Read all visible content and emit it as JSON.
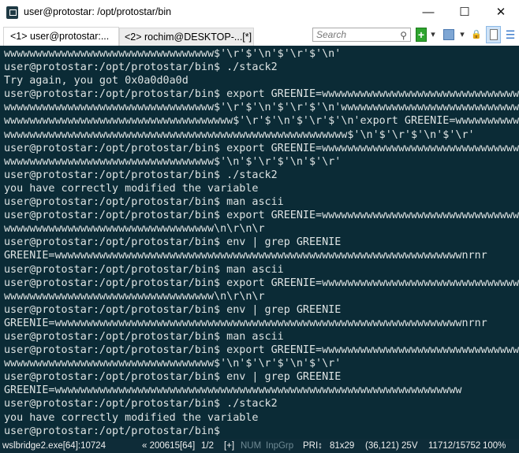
{
  "window": {
    "title": "user@protostar: /opt/protostar/bin",
    "minimize": "—",
    "maximize": "☐",
    "close": "✕"
  },
  "tabs": [
    {
      "label": "<1> user@protostar:...",
      "active": true
    },
    {
      "label": "<2> rochim@DESKTOP-...[*]",
      "active": false
    }
  ],
  "toolbar": {
    "search_placeholder": "Search",
    "search_icon": "⚲",
    "new_console": "+",
    "dropdown": "▾",
    "lock": "🔒",
    "menu": "☰"
  },
  "colors": {
    "terminal_bg": "#0b2b36",
    "terminal_fg": "#dde3e3",
    "new_console_green": "#2fa52f"
  },
  "terminal": {
    "lines": [
      "wwwwwwwwwwwwwwwwwwwwwwwwwwwwwwwww$'\\r'$'\\n'$'\\r'$'\\n'",
      "user@protostar:/opt/protostar/bin$ ./stack2",
      "Try again, you got 0x0a0d0a0d",
      "user@protostar:/opt/protostar/bin$ export GREENIE=wwwwwwwwwwwwwwwwwwwwwwwwwwwwwww",
      "wwwwwwwwwwwwwwwwwwwwwwwwwwwwwwwww$'\\r'$'\\n'$'\\r'$'\\n'wwwwwwwwwwwwwwwwwwwwwwwwwwww",
      "wwwwwwwwwwwwwwwwwwwwwwwwwwwwwwwwwwww$'\\r'$'\\n'$'\\r'$'\\n'export GREENIE=wwwwwwwwww",
      "wwwwwwwwwwwwwwwwwwwwwwwwwwwwwwwwwwwwwwwwwwwwwwwwwwwwww$'\\n'$'\\r'$'\\n'$'\\r'",
      "user@protostar:/opt/protostar/bin$ export GREENIE=wwwwwwwwwwwwwwwwwwwwwwwwwwwwwww",
      "wwwwwwwwwwwwwwwwwwwwwwwwwwwwwwwww$'\\n'$'\\r'$'\\n'$'\\r'",
      "user@protostar:/opt/protostar/bin$ ./stack2",
      "you have correctly modified the variable",
      "user@protostar:/opt/protostar/bin$ man ascii",
      "user@protostar:/opt/protostar/bin$ export GREENIE=wwwwwwwwwwwwwwwwwwwwwwwwwwwwwww",
      "wwwwwwwwwwwwwwwwwwwwwwwwwwwwwwwww\\n\\r\\n\\r",
      "user@protostar:/opt/protostar/bin$ env | grep GREENIE",
      "GREENIE=wwwwwwwwwwwwwwwwwwwwwwwwwwwwwwwwwwwwwwwwwwwwwwwwwwwwwwwwwwwwwwwwnrnr",
      "user@protostar:/opt/protostar/bin$ man ascii",
      "user@protostar:/opt/protostar/bin$ export GREENIE=wwwwwwwwwwwwwwwwwwwwwwwwwwwwwww",
      "wwwwwwwwwwwwwwwwwwwwwwwwwwwwwwwww\\n\\r\\n\\r",
      "user@protostar:/opt/protostar/bin$ env | grep GREENIE",
      "GREENIE=wwwwwwwwwwwwwwwwwwwwwwwwwwwwwwwwwwwwwwwwwwwwwwwwwwwwwwwwwwwwwwwwnrnr",
      "user@protostar:/opt/protostar/bin$ man ascii",
      "user@protostar:/opt/protostar/bin$ export GREENIE=wwwwwwwwwwwwwwwwwwwwwwwwwwwwwww",
      "wwwwwwwwwwwwwwwwwwwwwwwwwwwwwwwww$'\\n'$'\\r'$'\\n'$'\\r'",
      "user@protostar:/opt/protostar/bin$ env | grep GREENIE",
      "GREENIE=wwwwwwwwwwwwwwwwwwwwwwwwwwwwwwwwwwwwwwwwwwwwwwwwwwwwwwwwwwwwwwww",
      "user@protostar:/opt/protostar/bin$ ./stack2",
      "you have correctly modified the variable",
      "user@protostar:/opt/protostar/bin$"
    ]
  },
  "status": {
    "process": "wslbridge2.exe[64]:10724",
    "pid": "« 200615[64]",
    "console": "1/2",
    "plus": "[+]",
    "num": "NUM",
    "inpgrp": "InpGrp",
    "pri": "PRI↕",
    "size": "81x29",
    "cursor": "(36,121) 25V",
    "buffer": "11712/15752",
    "zoom": "100%"
  }
}
